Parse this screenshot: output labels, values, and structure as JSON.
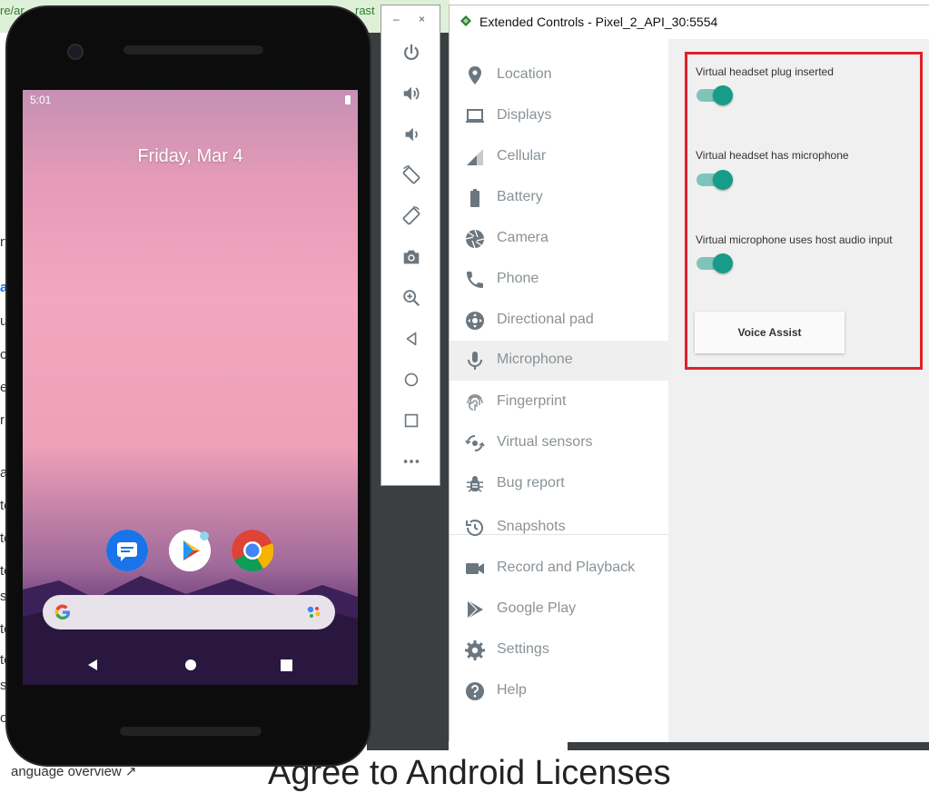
{
  "background": {
    "url_fragments": [
      "re/ar",
      "rast"
    ],
    "side_fragments": [
      "rt",
      "al",
      "u",
      "c",
      "e",
      "rr",
      "a",
      "te",
      "te",
      "te",
      "s",
      "te",
      "te",
      "s",
      "o"
    ],
    "bottom_link": "anguage overview ↗",
    "bottom_title": "Agree to Android Licenses"
  },
  "phone": {
    "time": "5:01",
    "date": "Friday, Mar 4",
    "apps": [
      "messages-icon",
      "play-store-icon",
      "chrome-icon"
    ],
    "search_icon": "google-g-icon",
    "assistant_icon": "assistant-dots-icon",
    "nav": [
      "back-icon",
      "home-icon",
      "recents-icon"
    ]
  },
  "toolbar": {
    "minimize": "–",
    "close": "×",
    "buttons": [
      "power-icon",
      "volume-up-icon",
      "volume-down-icon",
      "rotate-left-icon",
      "rotate-right-icon",
      "camera-icon",
      "zoom-icon",
      "back-icon",
      "home-icon",
      "overview-icon",
      "more-icon"
    ]
  },
  "extended_controls": {
    "title": "Extended Controls - Pixel_2_API_30:5554",
    "nav_items": [
      {
        "label": "Location",
        "icon": "location-pin-icon"
      },
      {
        "label": "Displays",
        "icon": "laptop-icon"
      },
      {
        "label": "Cellular",
        "icon": "signal-icon"
      },
      {
        "label": "Battery",
        "icon": "battery-icon"
      },
      {
        "label": "Camera",
        "icon": "aperture-icon"
      },
      {
        "label": "Phone",
        "icon": "phone-icon"
      },
      {
        "label": "Directional pad",
        "icon": "dpad-icon"
      },
      {
        "label": "Microphone",
        "icon": "microphone-icon"
      },
      {
        "label": "Fingerprint",
        "icon": "fingerprint-icon"
      },
      {
        "label": "Virtual sensors",
        "icon": "sensors-icon"
      },
      {
        "label": "Bug report",
        "icon": "bug-icon"
      },
      {
        "label": "Snapshots",
        "icon": "history-icon"
      },
      {
        "label": "Record and Playback",
        "icon": "video-camera-icon"
      },
      {
        "label": "Google Play",
        "icon": "play-icon"
      },
      {
        "label": "Settings",
        "icon": "gear-icon"
      },
      {
        "label": "Help",
        "icon": "help-icon"
      }
    ],
    "active_item": "Microphone",
    "microphone": {
      "headset_plug_label": "Virtual headset plug inserted",
      "headset_plug_on": true,
      "headset_mic_label": "Virtual headset has microphone",
      "headset_mic_on": true,
      "host_audio_label": "Virtual microphone uses host audio input",
      "host_audio_on": true,
      "voice_assist_label": "Voice Assist"
    }
  },
  "colors": {
    "accent_toggle": "#169c88",
    "highlight_box": "#e0202a"
  }
}
